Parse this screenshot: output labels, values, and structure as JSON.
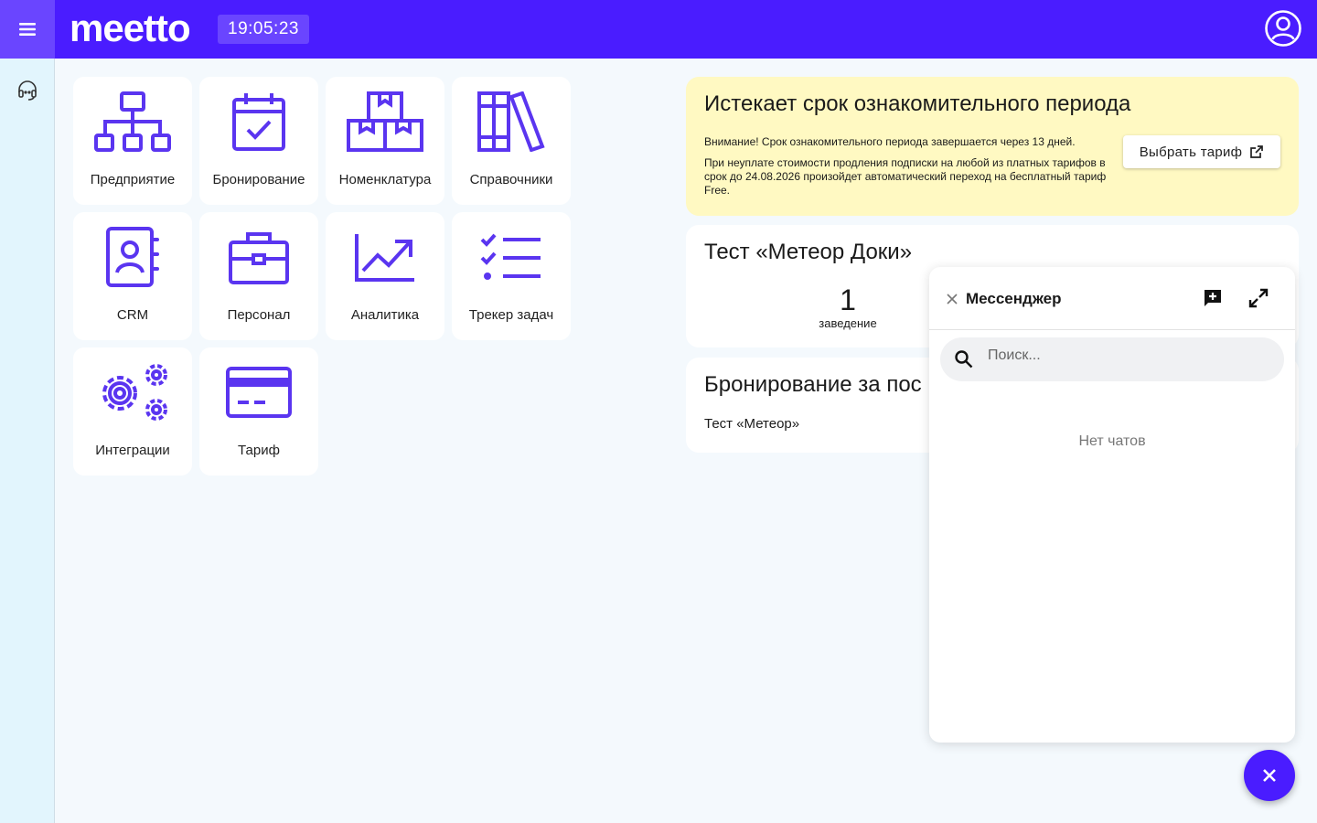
{
  "header": {
    "logo_text": "meetto",
    "clock": "19:05:23",
    "brand_color": "#4a1cff",
    "menu_icon": "hamburger-icon",
    "user_icon": "user-circle-icon"
  },
  "sidebar": {
    "items": [
      {
        "icon": "headset-support-icon"
      }
    ]
  },
  "modules": [
    {
      "label": "Предприятие",
      "icon": "org-structure-icon"
    },
    {
      "label": "Бронирование",
      "icon": "calendar-check-icon"
    },
    {
      "label": "Номенклатура",
      "icon": "boxes-icon"
    },
    {
      "label": "Справочники",
      "icon": "books-icon"
    },
    {
      "label": "CRM",
      "icon": "contact-book-icon"
    },
    {
      "label": "Персонал",
      "icon": "briefcase-icon"
    },
    {
      "label": "Аналитика",
      "icon": "chart-trend-icon"
    },
    {
      "label": "Трекер задач",
      "icon": "task-list-icon"
    },
    {
      "label": "Интеграции",
      "icon": "gears-icon"
    },
    {
      "label": "Тариф",
      "icon": "credit-card-icon"
    }
  ],
  "trial_card": {
    "title": "Истекает срок ознакомительного периода",
    "warning": "Внимание! Срок ознакомительного периода завершается через 13 дней.",
    "info": "При неуплате стоимости продления подписки на любой из платных тарифов в срок до 24.08.2026 произойдет автоматический переход на бесплатный тариф Free.",
    "button_label": "Выбрать тариф",
    "background": "#fff9c2"
  },
  "docs_card": {
    "title": "Тест «Метеор Доки»",
    "count": "1",
    "count_label": "заведение"
  },
  "bookings_card": {
    "title": "Бронирование за пос",
    "items": [
      "Тест «Метеор»"
    ]
  },
  "messenger": {
    "title": "Мессенджер",
    "search_placeholder": "Поиск...",
    "search_value": "",
    "empty_text": "Нет чатов"
  }
}
